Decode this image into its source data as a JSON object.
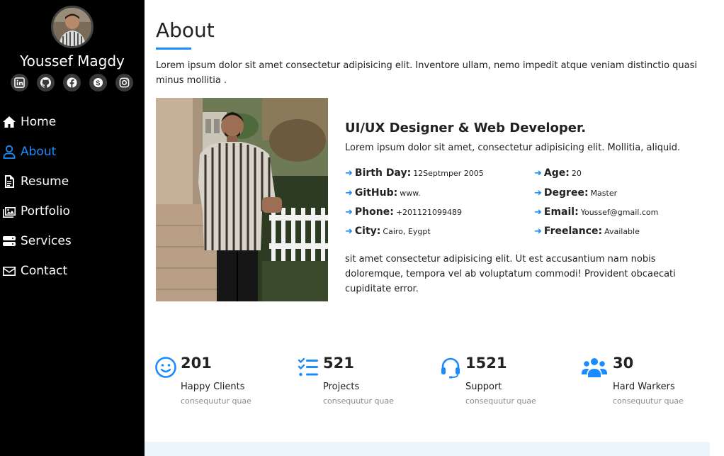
{
  "sidebar": {
    "name": "Youssef Magdy",
    "socials": [
      "linkedin-icon",
      "github-icon",
      "facebook-icon",
      "skype-icon",
      "instagram-icon"
    ],
    "nav": [
      {
        "label": "Home",
        "icon": "home-icon"
      },
      {
        "label": "About",
        "icon": "user-icon",
        "active": true
      },
      {
        "label": "Resume",
        "icon": "file-icon"
      },
      {
        "label": "Portfolio",
        "icon": "images-icon"
      },
      {
        "label": "Services",
        "icon": "server-icon"
      },
      {
        "label": "Contact",
        "icon": "envelope-icon"
      }
    ]
  },
  "about": {
    "title": "About",
    "intro": "Lorem ipsum dolor sit amet consectetur adipisicing elit. Inventore ullam, nemo impedit atque veniam distinctio quasi minus mollitia .",
    "role": "UI/UX Designer & Web Developer.",
    "role_desc": "Lorem ipsum dolor sit amet, consectetur adipisicing elit. Mollitia, aliquid.",
    "facts": [
      {
        "label": "Birth Day:",
        "value": "12Septmper 2005"
      },
      {
        "label": "Age:",
        "value": "20"
      },
      {
        "label": "GitHub:",
        "value": "www."
      },
      {
        "label": "Degree:",
        "value": "Master"
      },
      {
        "label": "Phone:",
        "value": "+201121099489"
      },
      {
        "label": "Email:",
        "value": "Youssef@gmail.com"
      },
      {
        "label": "City:",
        "value": "Cairo, Eygpt"
      },
      {
        "label": "Freelance:",
        "value": "Available"
      }
    ],
    "outro": "sit amet consectetur adipisicing elit. Ut est accusantium nam nobis doloremque, tempora vel ab voluptatum commodi! Provident obcaecati cupiditate error."
  },
  "stats": [
    {
      "number": "201",
      "label": "Happy Clients",
      "sub": "consequutur quae",
      "icon": "smile-icon"
    },
    {
      "number": "521",
      "label": "Projects",
      "sub": "consequutur quae",
      "icon": "list-check-icon"
    },
    {
      "number": "1521",
      "label": "Support",
      "sub": "consequutur quae",
      "icon": "headset-icon"
    },
    {
      "number": "30",
      "label": "Hard Warkers",
      "sub": "consequutur quae",
      "icon": "users-icon"
    }
  ],
  "colors": {
    "accent": "#1a8cff",
    "sidebar_bg": "#000000",
    "band": "#eef6fd"
  }
}
